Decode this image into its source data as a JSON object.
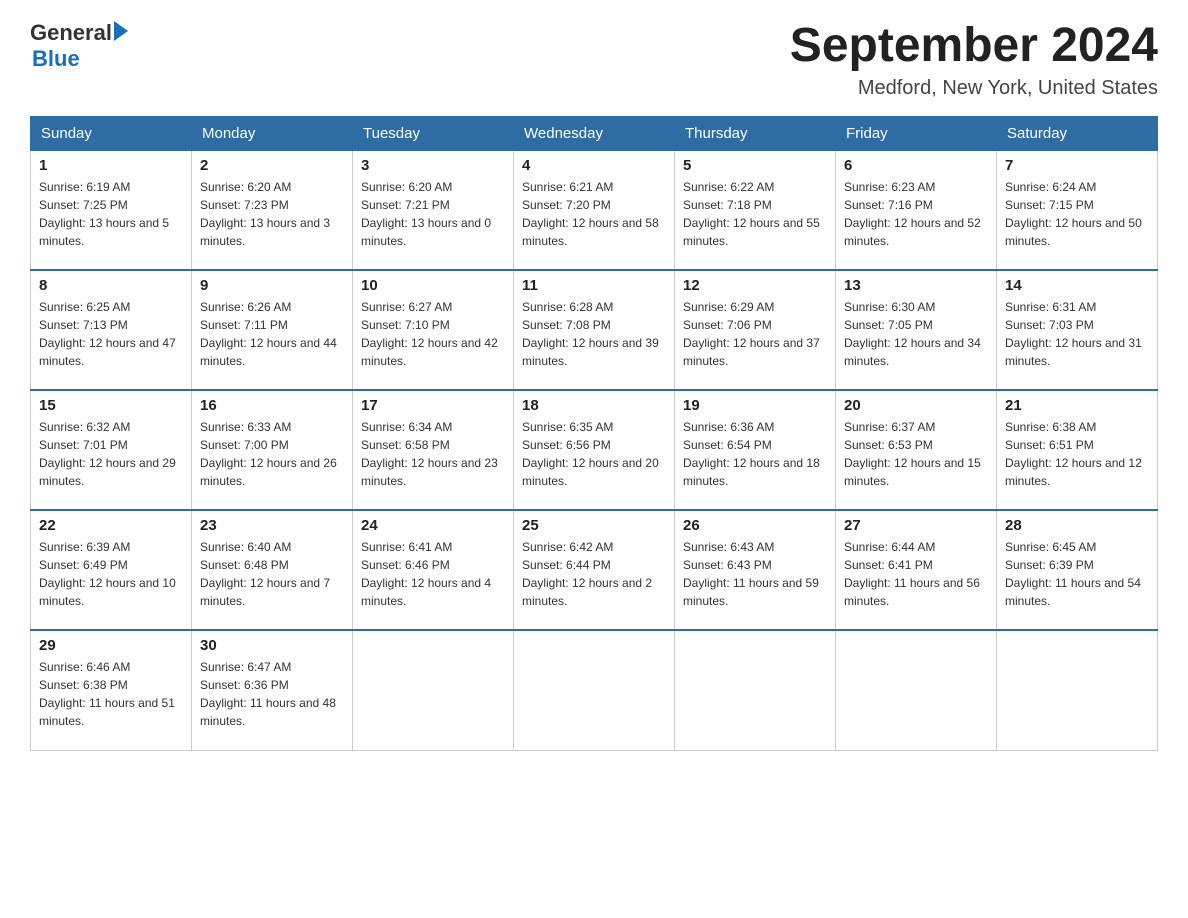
{
  "logo": {
    "text_general": "General",
    "text_blue": "Blue",
    "triangle": "▶"
  },
  "header": {
    "month_title": "September 2024",
    "location": "Medford, New York, United States"
  },
  "weekdays": [
    "Sunday",
    "Monday",
    "Tuesday",
    "Wednesday",
    "Thursday",
    "Friday",
    "Saturday"
  ],
  "weeks": [
    [
      {
        "day": "1",
        "sunrise": "6:19 AM",
        "sunset": "7:25 PM",
        "daylight": "13 hours and 5 minutes."
      },
      {
        "day": "2",
        "sunrise": "6:20 AM",
        "sunset": "7:23 PM",
        "daylight": "13 hours and 3 minutes."
      },
      {
        "day": "3",
        "sunrise": "6:20 AM",
        "sunset": "7:21 PM",
        "daylight": "13 hours and 0 minutes."
      },
      {
        "day": "4",
        "sunrise": "6:21 AM",
        "sunset": "7:20 PM",
        "daylight": "12 hours and 58 minutes."
      },
      {
        "day": "5",
        "sunrise": "6:22 AM",
        "sunset": "7:18 PM",
        "daylight": "12 hours and 55 minutes."
      },
      {
        "day": "6",
        "sunrise": "6:23 AM",
        "sunset": "7:16 PM",
        "daylight": "12 hours and 52 minutes."
      },
      {
        "day": "7",
        "sunrise": "6:24 AM",
        "sunset": "7:15 PM",
        "daylight": "12 hours and 50 minutes."
      }
    ],
    [
      {
        "day": "8",
        "sunrise": "6:25 AM",
        "sunset": "7:13 PM",
        "daylight": "12 hours and 47 minutes."
      },
      {
        "day": "9",
        "sunrise": "6:26 AM",
        "sunset": "7:11 PM",
        "daylight": "12 hours and 44 minutes."
      },
      {
        "day": "10",
        "sunrise": "6:27 AM",
        "sunset": "7:10 PM",
        "daylight": "12 hours and 42 minutes."
      },
      {
        "day": "11",
        "sunrise": "6:28 AM",
        "sunset": "7:08 PM",
        "daylight": "12 hours and 39 minutes."
      },
      {
        "day": "12",
        "sunrise": "6:29 AM",
        "sunset": "7:06 PM",
        "daylight": "12 hours and 37 minutes."
      },
      {
        "day": "13",
        "sunrise": "6:30 AM",
        "sunset": "7:05 PM",
        "daylight": "12 hours and 34 minutes."
      },
      {
        "day": "14",
        "sunrise": "6:31 AM",
        "sunset": "7:03 PM",
        "daylight": "12 hours and 31 minutes."
      }
    ],
    [
      {
        "day": "15",
        "sunrise": "6:32 AM",
        "sunset": "7:01 PM",
        "daylight": "12 hours and 29 minutes."
      },
      {
        "day": "16",
        "sunrise": "6:33 AM",
        "sunset": "7:00 PM",
        "daylight": "12 hours and 26 minutes."
      },
      {
        "day": "17",
        "sunrise": "6:34 AM",
        "sunset": "6:58 PM",
        "daylight": "12 hours and 23 minutes."
      },
      {
        "day": "18",
        "sunrise": "6:35 AM",
        "sunset": "6:56 PM",
        "daylight": "12 hours and 20 minutes."
      },
      {
        "day": "19",
        "sunrise": "6:36 AM",
        "sunset": "6:54 PM",
        "daylight": "12 hours and 18 minutes."
      },
      {
        "day": "20",
        "sunrise": "6:37 AM",
        "sunset": "6:53 PM",
        "daylight": "12 hours and 15 minutes."
      },
      {
        "day": "21",
        "sunrise": "6:38 AM",
        "sunset": "6:51 PM",
        "daylight": "12 hours and 12 minutes."
      }
    ],
    [
      {
        "day": "22",
        "sunrise": "6:39 AM",
        "sunset": "6:49 PM",
        "daylight": "12 hours and 10 minutes."
      },
      {
        "day": "23",
        "sunrise": "6:40 AM",
        "sunset": "6:48 PM",
        "daylight": "12 hours and 7 minutes."
      },
      {
        "day": "24",
        "sunrise": "6:41 AM",
        "sunset": "6:46 PM",
        "daylight": "12 hours and 4 minutes."
      },
      {
        "day": "25",
        "sunrise": "6:42 AM",
        "sunset": "6:44 PM",
        "daylight": "12 hours and 2 minutes."
      },
      {
        "day": "26",
        "sunrise": "6:43 AM",
        "sunset": "6:43 PM",
        "daylight": "11 hours and 59 minutes."
      },
      {
        "day": "27",
        "sunrise": "6:44 AM",
        "sunset": "6:41 PM",
        "daylight": "11 hours and 56 minutes."
      },
      {
        "day": "28",
        "sunrise": "6:45 AM",
        "sunset": "6:39 PM",
        "daylight": "11 hours and 54 minutes."
      }
    ],
    [
      {
        "day": "29",
        "sunrise": "6:46 AM",
        "sunset": "6:38 PM",
        "daylight": "11 hours and 51 minutes."
      },
      {
        "day": "30",
        "sunrise": "6:47 AM",
        "sunset": "6:36 PM",
        "daylight": "11 hours and 48 minutes."
      },
      null,
      null,
      null,
      null,
      null
    ]
  ]
}
